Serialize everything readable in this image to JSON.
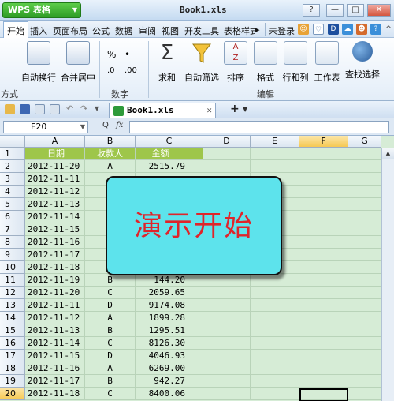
{
  "titlebar": {
    "app_button": "WPS 表格",
    "doc_title": "Book1.xls",
    "window_buttons": [
      "?",
      "—",
      "□",
      "✕"
    ]
  },
  "menubar": {
    "items": [
      "开始",
      "插入",
      "页面布局",
      "公式",
      "数据",
      "审阅",
      "视图",
      "开发工具",
      "表格样式"
    ],
    "login": "未登录",
    "overflow": "▸"
  },
  "ribbon": {
    "buttons": [
      "自动换行",
      "合并居中",
      "求和",
      "自动筛选",
      "排序",
      "格式",
      "行和列",
      "工作表",
      "查找选择"
    ],
    "number_symbols": [
      "%",
      "•",
      ".0",
      ".00"
    ],
    "groups": [
      "方式",
      "数字",
      "编辑"
    ]
  },
  "doctoolbar": {
    "tab_label": "Book1.xls",
    "tab_close": "✕",
    "add_tab": "+"
  },
  "formulabar": {
    "cell_ref": "F20",
    "fx": "fx",
    "value": ""
  },
  "grid": {
    "columns": [
      "A",
      "B",
      "C",
      "D",
      "E",
      "F",
      "G"
    ],
    "selected_column": "F",
    "header_row": {
      "row": "1",
      "a": "日期",
      "b": "收款人",
      "c": "金额"
    },
    "rows": [
      {
        "row": "2",
        "a": "2012-11-20",
        "b": "A",
        "c": "2515.79"
      },
      {
        "row": "3",
        "a": "2012-11-11",
        "b": "",
        "c": ""
      },
      {
        "row": "4",
        "a": "2012-11-12",
        "b": "",
        "c": ""
      },
      {
        "row": "5",
        "a": "2012-11-13",
        "b": "",
        "c": ""
      },
      {
        "row": "6",
        "a": "2012-11-14",
        "b": "",
        "c": ""
      },
      {
        "row": "7",
        "a": "2012-11-15",
        "b": "",
        "c": ""
      },
      {
        "row": "8",
        "a": "2012-11-16",
        "b": "",
        "c": ""
      },
      {
        "row": "9",
        "a": "2012-11-17",
        "b": "",
        "c": ""
      },
      {
        "row": "10",
        "a": "2012-11-18",
        "b": "",
        "c": ""
      },
      {
        "row": "11",
        "a": "2012-11-19",
        "b": "B",
        "c": "144.20"
      },
      {
        "row": "12",
        "a": "2012-11-20",
        "b": "C",
        "c": "2059.65"
      },
      {
        "row": "13",
        "a": "2012-11-11",
        "b": "D",
        "c": "9174.08"
      },
      {
        "row": "14",
        "a": "2012-11-12",
        "b": "A",
        "c": "1899.28"
      },
      {
        "row": "15",
        "a": "2012-11-13",
        "b": "B",
        "c": "1295.51"
      },
      {
        "row": "16",
        "a": "2012-11-14",
        "b": "C",
        "c": "8126.30"
      },
      {
        "row": "17",
        "a": "2012-11-15",
        "b": "D",
        "c": "4046.93"
      },
      {
        "row": "18",
        "a": "2012-11-16",
        "b": "A",
        "c": "6269.00"
      },
      {
        "row": "19",
        "a": "2012-11-17",
        "b": "B",
        "c": "942.27"
      },
      {
        "row": "20",
        "a": "2012-11-18",
        "b": "C",
        "c": "8400.06"
      }
    ],
    "selected_row": "20"
  },
  "overlay": {
    "text": "演示开始"
  }
}
